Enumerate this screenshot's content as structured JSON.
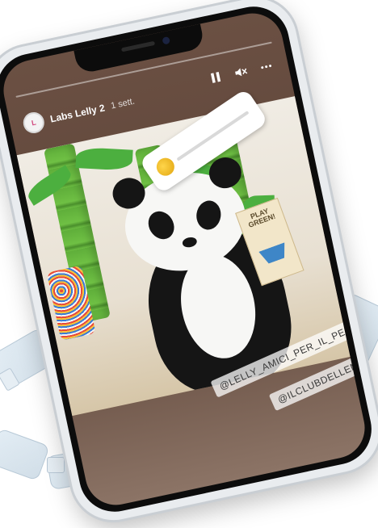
{
  "story": {
    "username": "Labs Lelly 2",
    "time": "1 sett.",
    "progress": 0.0
  },
  "controls": {
    "pause_icon": "pause-icon",
    "mute_icon": "mute-icon",
    "more_icon": "more-icon"
  },
  "tag": {
    "title": "PLAY GREEN!"
  },
  "mentions": [
    "@LELLY_AMICI_PER_IL_PELUCHE",
    "@ILCLUBDELLEMAMME"
  ],
  "colors": {
    "screen_bg": "#6b5043",
    "bamboo": "#5fae3a",
    "mention_bg": "#ffffff"
  }
}
